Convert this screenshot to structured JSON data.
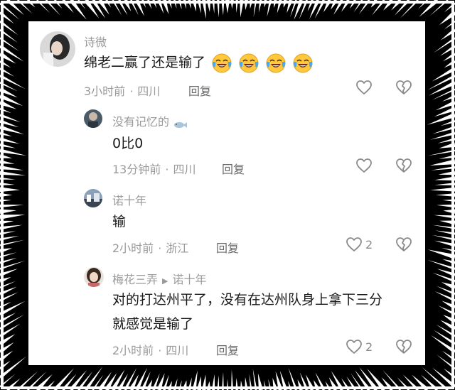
{
  "comments": [
    {
      "user": "诗微",
      "text": "绵老二赢了还是输了",
      "time": "3小时前",
      "location": "四川",
      "reply_label": "回复",
      "likes": "",
      "emoji": [
        "laugh-cry-emoji",
        "laugh-cry-emoji",
        "laugh-cry-emoji",
        "laugh-cry-emoji"
      ]
    },
    {
      "user": "没有记忆的",
      "text": "0比0",
      "time": "13分钟前",
      "location": "四川",
      "reply_label": "回复",
      "likes": "",
      "name_icon": "fish-icon"
    },
    {
      "user": "诺十年",
      "text": "输",
      "time": "2小时前",
      "location": "浙江",
      "reply_label": "回复",
      "likes": "2"
    },
    {
      "user": "梅花三弄",
      "reply_to": "诺十年",
      "text_line1": "对的打达州平了，没有在达州队身上拿下三分",
      "text_line2": "就感觉是输了",
      "time": "2小时前",
      "location": "四川",
      "reply_label": "回复",
      "likes": "2"
    }
  ],
  "separator": "·",
  "colors": {
    "meta": "#9a9a9a",
    "text": "#1a1a1a",
    "frame": "#000000"
  }
}
